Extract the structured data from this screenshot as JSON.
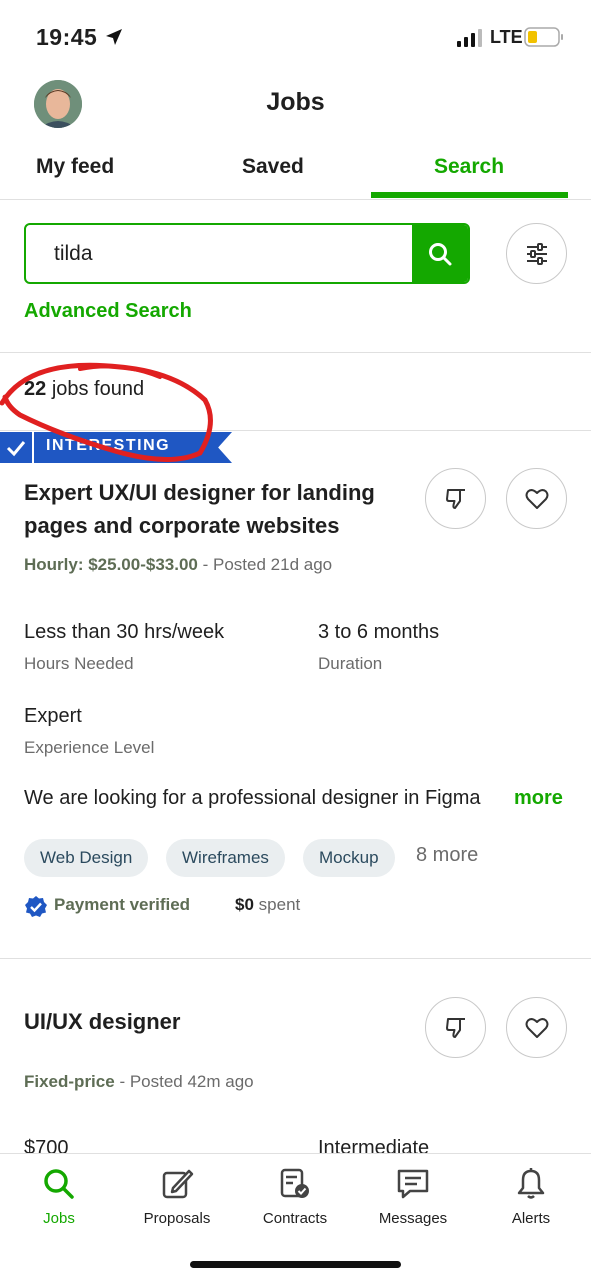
{
  "status_bar": {
    "time": "19:45",
    "network": "LTE"
  },
  "header": {
    "title": "Jobs"
  },
  "tabs": [
    {
      "label": "My feed"
    },
    {
      "label": "Saved"
    },
    {
      "label": "Search"
    }
  ],
  "search": {
    "value": "tilda",
    "advanced_label": "Advanced Search"
  },
  "results": {
    "count": "22",
    "suffix": "jobs found"
  },
  "jobs": [
    {
      "badge": "INTERESTING",
      "title": "Expert UX/UI designer for landing pages and corporate websites",
      "rate": "Hourly: $25.00-$33.00",
      "posted": "- Posted 21d ago",
      "hours_value": "Less than 30 hrs/week",
      "hours_label": "Hours Needed",
      "duration_value": "3 to 6 months",
      "duration_label": "Duration",
      "level_value": "Expert",
      "level_label": "Experience Level",
      "description": "We are looking for a professional designer in Figma",
      "more_label": "more",
      "skills": [
        "Web Design",
        "Wireframes",
        "Mockup"
      ],
      "more_skills": "8 more",
      "payment": "Payment verified",
      "spent_amount": "$0",
      "spent_label": "spent"
    },
    {
      "title": "UI/UX designer",
      "rate": "Fixed-price",
      "posted": "- Posted 42m ago",
      "budget": "$700",
      "level_value": "Intermediate"
    }
  ],
  "bottom_nav": [
    {
      "label": "Jobs",
      "icon": "search-icon"
    },
    {
      "label": "Proposals",
      "icon": "proposal-icon"
    },
    {
      "label": "Contracts",
      "icon": "contract-icon"
    },
    {
      "label": "Messages",
      "icon": "message-icon"
    },
    {
      "label": "Alerts",
      "icon": "bell-icon"
    }
  ],
  "colors": {
    "accent": "#14a800",
    "badge": "#1f57c3",
    "annotation": "#e02020"
  }
}
